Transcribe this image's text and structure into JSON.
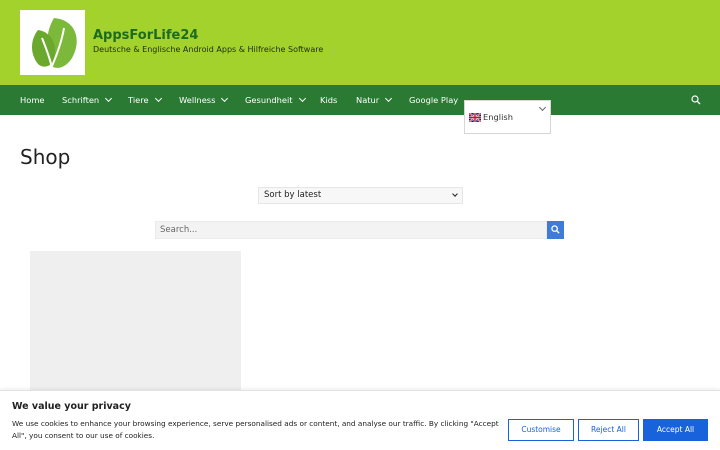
{
  "site": {
    "title": "AppsForLife24",
    "description": "Deutsche & Englische Android Apps & Hilfreiche Software"
  },
  "nav": {
    "items": [
      {
        "label": "Home"
      },
      {
        "label": "Schriften"
      },
      {
        "label": "Tiere"
      },
      {
        "label": "Wellness"
      },
      {
        "label": "Gesundheit"
      },
      {
        "label": "Kids"
      },
      {
        "label": "Natur"
      },
      {
        "label": "Google Play"
      }
    ]
  },
  "language": {
    "selected": "English"
  },
  "page": {
    "title": "Shop"
  },
  "sort": {
    "selected": "Sort by latest"
  },
  "search": {
    "placeholder": "Search..."
  },
  "cookie": {
    "title": "We value your privacy",
    "text": "We use cookies to enhance your browsing experience, serve personalised ads or content, and analyse our traffic. By clicking \"Accept All\", you consent to our use of cookies.",
    "customise_label": "Customise",
    "reject_label": "Reject All",
    "accept_label": "Accept All"
  },
  "colors": {
    "header_bg": "#a4d22d",
    "nav_bg": "#2a7a34",
    "accent_blue": "#1863dc"
  },
  "icons": [
    "leaf-logo-icon",
    "chevron-down-icon",
    "search-icon",
    "uk-flag-icon"
  ]
}
